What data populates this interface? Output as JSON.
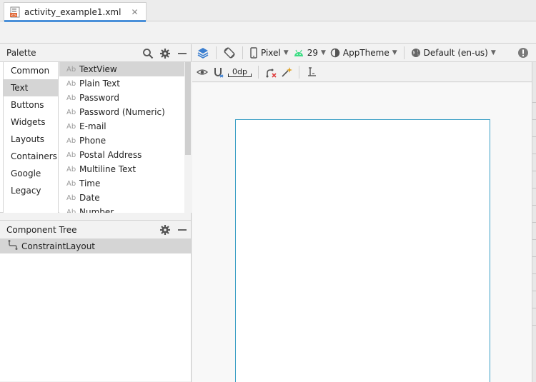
{
  "tab": {
    "filename": "activity_example1.xml",
    "close": "✕"
  },
  "palette": {
    "title": "Palette",
    "categories": [
      "Common",
      "Text",
      "Buttons",
      "Widgets",
      "Layouts",
      "Containers",
      "Google",
      "Legacy"
    ],
    "selected_category": "Text",
    "items": [
      "TextView",
      "Plain Text",
      "Password",
      "Password (Numeric)",
      "E-mail",
      "Phone",
      "Postal Address",
      "Multiline Text",
      "Time",
      "Date",
      "Number"
    ],
    "item_icon_text": "Ab",
    "selected_item": "TextView"
  },
  "component_tree": {
    "title": "Component Tree",
    "root": "ConstraintLayout"
  },
  "toolbar": {
    "device": "Pixel",
    "api": "29",
    "theme": "AppTheme",
    "locale": "Default (en-us)",
    "margin": "0dp"
  },
  "colors": {
    "accent": "#4a90d9",
    "device_border": "#3a9fc5",
    "android_green": "#3ddc84"
  }
}
